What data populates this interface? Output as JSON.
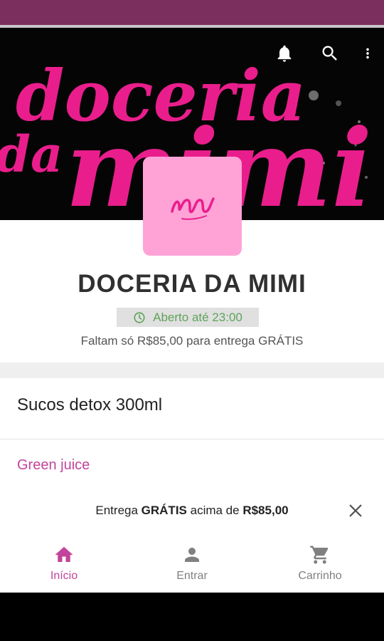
{
  "colors": {
    "status_bar": "#7b2f5e",
    "brand_pink": "#e91e8c",
    "logo_bg": "#ffa3d7",
    "accent": "#c2449b",
    "open_green": "#5fa35a"
  },
  "header": {
    "banner_lines": [
      "doceria",
      "da",
      "mimi"
    ],
    "actions": [
      {
        "icon": "bell-icon"
      },
      {
        "icon": "search-icon"
      },
      {
        "icon": "more-vert-icon"
      }
    ]
  },
  "store": {
    "name": "DOCERIA DA MIMI",
    "open_status": "Aberto até 23:00",
    "free_delivery_info": "Faltam só R$85,00 para entrega GRÁTIS"
  },
  "menu": {
    "category": "Sucos detox 300ml",
    "products": [
      "Green juice"
    ]
  },
  "promo": {
    "part1": "Entrega ",
    "part2": "GRÁTIS",
    "part3": " acima de ",
    "part4": "R$85,00"
  },
  "nav": {
    "items": [
      {
        "label": "Início",
        "icon": "home-icon",
        "active": true
      },
      {
        "label": "Entrar",
        "icon": "person-icon",
        "active": false
      },
      {
        "label": "Carrinho",
        "icon": "cart-icon",
        "active": false
      }
    ]
  }
}
